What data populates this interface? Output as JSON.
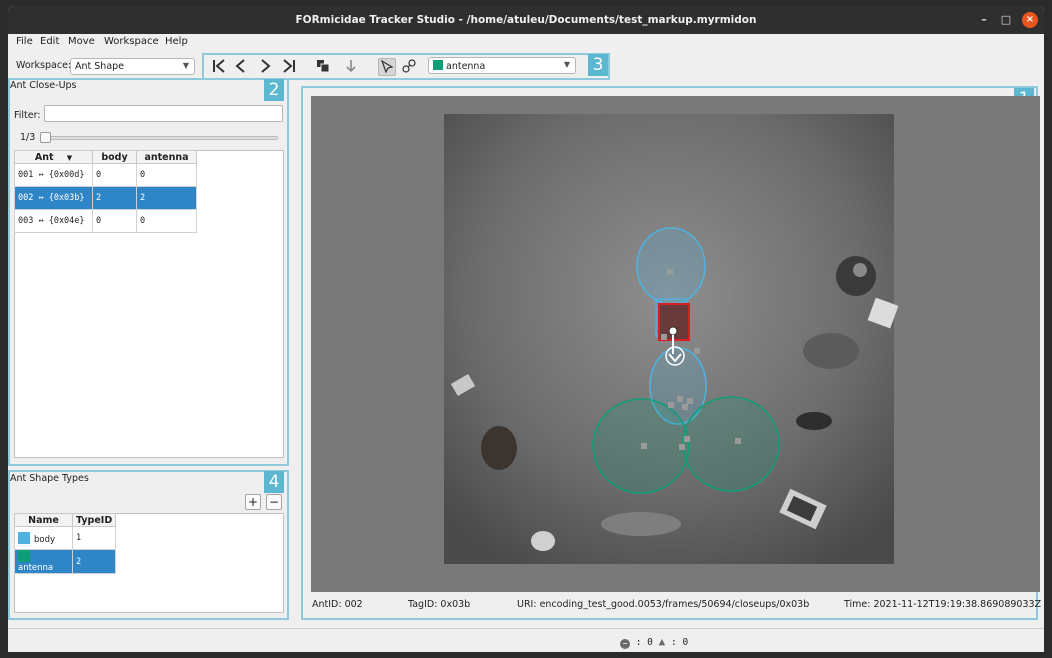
{
  "window": {
    "title": "FORmicidae Tracker Studio - /home/atuleu/Documents/test_markup.myrmidon",
    "controls": {
      "minimize": "–",
      "maximize": "□",
      "close": "×"
    }
  },
  "menu": [
    "File",
    "Edit",
    "Move",
    "Workspace",
    "Help"
  ],
  "toolbar": {
    "workspace_label": "Workspace:",
    "workspace_value": "Ant Shape",
    "shape_type_value": "antenna",
    "shape_type_color": "#0f9e78",
    "buttons": [
      "first-icon",
      "previous-icon",
      "next-icon",
      "last-icon",
      "copy-icon",
      "download-arrow-icon",
      "select-pointer-icon",
      "edit-shape-icon"
    ]
  },
  "badges": {
    "viewer": "1",
    "closeups": "2",
    "toolbar": "3",
    "shape_types": "4"
  },
  "closeups": {
    "title": "Ant Close-Ups",
    "filter_label": "Filter:",
    "filter_value": "",
    "frame_label": "1/3",
    "frame_fraction": 0.0,
    "columns": [
      "Ant",
      "body",
      "antenna"
    ],
    "rows": [
      {
        "ant": "001 ↔ {0x00d}",
        "body": "0",
        "antenna": "0"
      },
      {
        "ant": "002 ↔ {0x03b}",
        "body": "2",
        "antenna": "2"
      },
      {
        "ant": "003 ↔ {0x04e}",
        "body": "0",
        "antenna": "0"
      }
    ],
    "selected_row": 1
  },
  "shape_types": {
    "title": "Ant Shape Types",
    "add": "+",
    "remove": "−",
    "columns": [
      "Name",
      "TypeID"
    ],
    "rows": [
      {
        "name": "body",
        "id": "1",
        "color": "#4fb3e2"
      },
      {
        "name": "antenna",
        "id": "2",
        "color": "#0f9e78"
      }
    ],
    "selected_row": 1
  },
  "status": {
    "ant_id": "AntID: 002",
    "tag_id": "TagID: 0x03b",
    "uri": "URI: encoding_test_good.0053/frames/50694/closeups/0x03b",
    "time": "Time: 2021-11-12T19:19:38.869089033Z"
  },
  "footer": {
    "errors": ": 0",
    "warnings": ": 0"
  },
  "colors": {
    "accent": "#8fc9dc",
    "badge": "#5cb8d1",
    "selection": "#2f86c7",
    "body_shape": "#4fb3e2",
    "antenna_shape": "#0f9e78"
  }
}
